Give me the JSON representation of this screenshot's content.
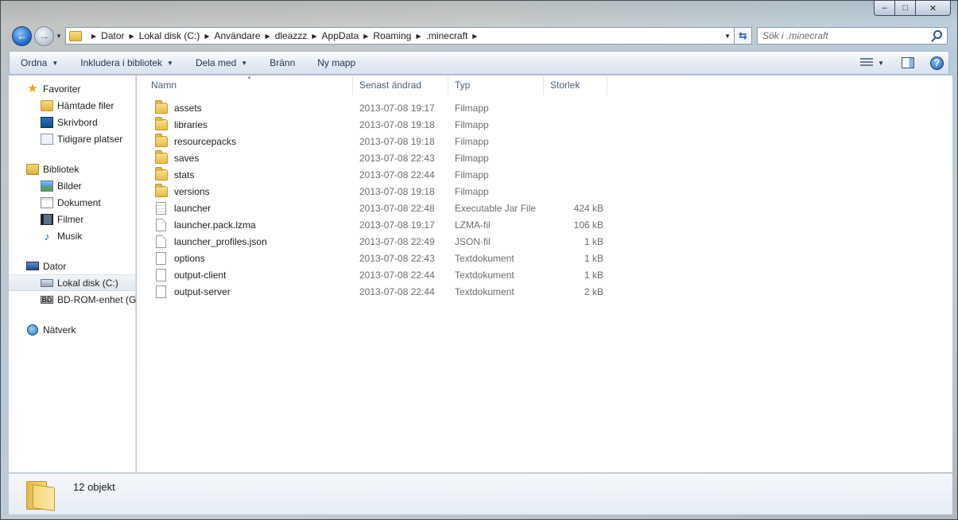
{
  "window": {
    "caption": {
      "minimize": "–",
      "maximize": "□",
      "close": "✕"
    }
  },
  "address": {
    "crumbs": [
      "Dator",
      "Lokal disk (C:)",
      "Användare",
      "dleazzz",
      "AppData",
      "Roaming",
      ".minecraft"
    ]
  },
  "search": {
    "placeholder": "Sök i .minecraft"
  },
  "commandbar": {
    "organize": "Ordna",
    "include": "Inkludera i bibliotek",
    "share": "Dela med",
    "burn": "Bränn",
    "new_folder": "Ny mapp",
    "help": "?"
  },
  "navpane": {
    "favorites": {
      "label": "Favoriter",
      "items": [
        "Hämtade filer",
        "Skrivbord",
        "Tidigare platser"
      ]
    },
    "libraries": {
      "label": "Bibliotek",
      "items": [
        "Bilder",
        "Dokument",
        "Filmer",
        "Musik"
      ]
    },
    "computer": {
      "label": "Dator",
      "items": [
        "Lokal disk (C:)",
        "BD-ROM-enhet (G:)"
      ],
      "bd_badge": "BD"
    },
    "network": {
      "label": "Nätverk"
    }
  },
  "columns": {
    "name": "Namn",
    "date": "Senast ändrad",
    "type": "Typ",
    "size": "Storlek"
  },
  "files": [
    {
      "name": "assets",
      "date": "2013-07-08 19:17",
      "type": "Filmapp",
      "size": "",
      "icon": "folder"
    },
    {
      "name": "libraries",
      "date": "2013-07-08 19:18",
      "type": "Filmapp",
      "size": "",
      "icon": "folder"
    },
    {
      "name": "resourcepacks",
      "date": "2013-07-08 19:18",
      "type": "Filmapp",
      "size": "",
      "icon": "folder"
    },
    {
      "name": "saves",
      "date": "2013-07-08 22:43",
      "type": "Filmapp",
      "size": "",
      "icon": "folder"
    },
    {
      "name": "stats",
      "date": "2013-07-08 22:44",
      "type": "Filmapp",
      "size": "",
      "icon": "folder"
    },
    {
      "name": "versions",
      "date": "2013-07-08 19:18",
      "type": "Filmapp",
      "size": "",
      "icon": "folder"
    },
    {
      "name": "launcher",
      "date": "2013-07-08 22:48",
      "type": "Executable Jar File",
      "size": "424 kB",
      "icon": "jar"
    },
    {
      "name": "launcher.pack.lzma",
      "date": "2013-07-08 19:17",
      "type": "LZMA-fil",
      "size": "106 kB",
      "icon": "file"
    },
    {
      "name": "launcher_profiles.json",
      "date": "2013-07-08 22:49",
      "type": "JSON-fil",
      "size": "1 kB",
      "icon": "file"
    },
    {
      "name": "options",
      "date": "2013-07-08 22:43",
      "type": "Textdokument",
      "size": "1 kB",
      "icon": "txt"
    },
    {
      "name": "output-client",
      "date": "2013-07-08 22:44",
      "type": "Textdokument",
      "size": "1 kB",
      "icon": "txt"
    },
    {
      "name": "output-server",
      "date": "2013-07-08 22:44",
      "type": "Textdokument",
      "size": "2 kB",
      "icon": "txt"
    }
  ],
  "details": {
    "count": "12 objekt"
  }
}
